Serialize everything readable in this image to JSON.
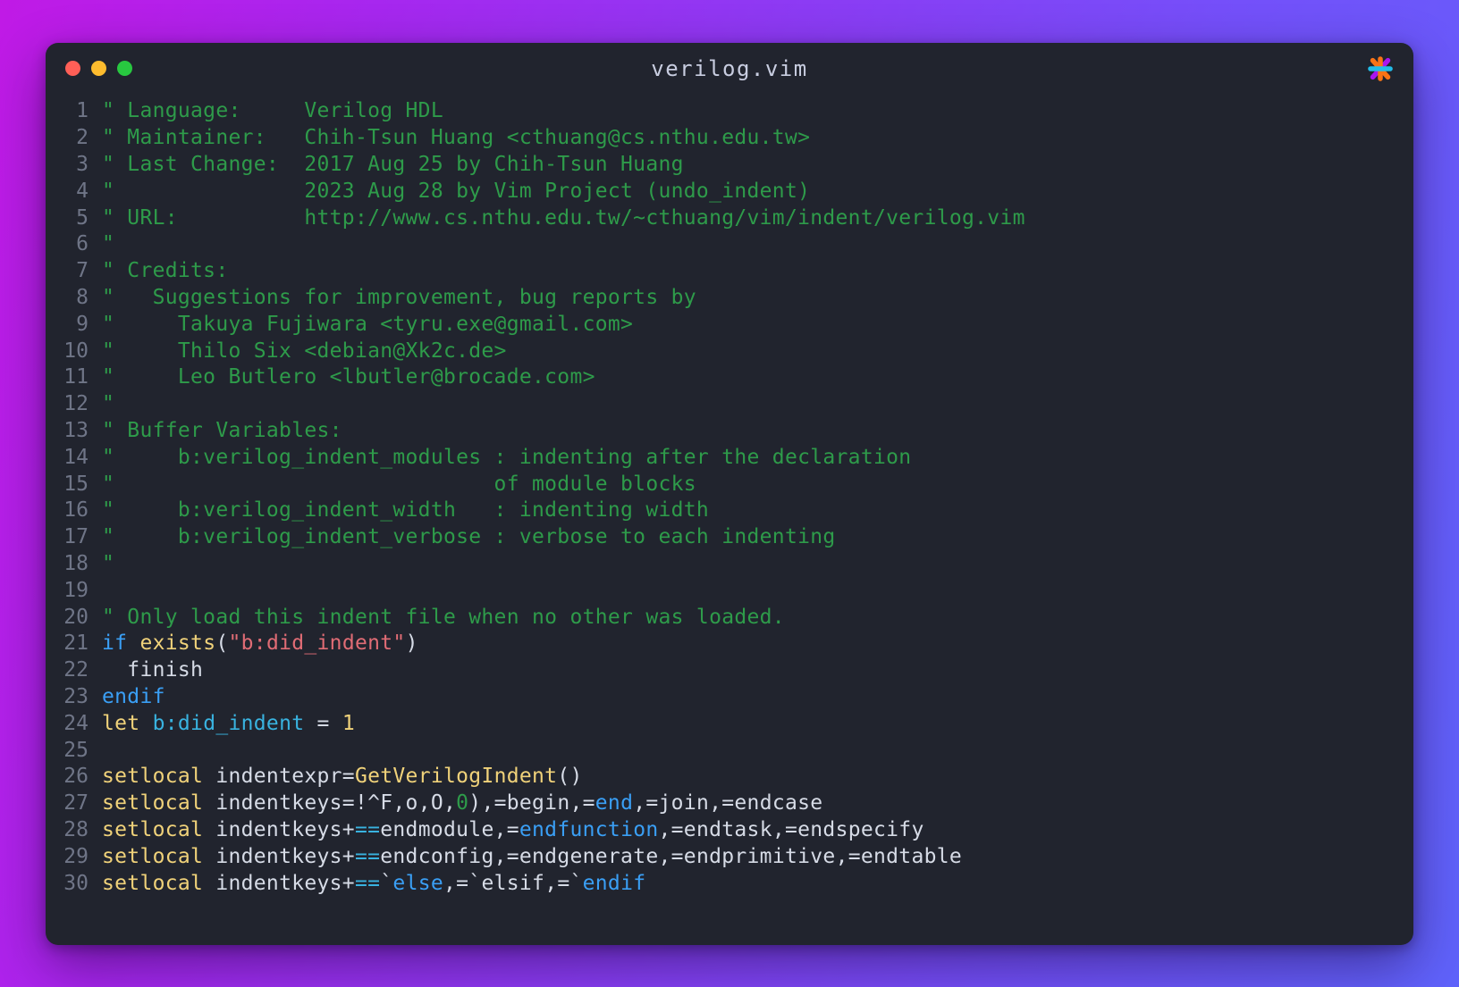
{
  "window": {
    "title": "verilog.vim",
    "traffic_lights": [
      {
        "name": "close",
        "color": "#ff5f57"
      },
      {
        "name": "minimize",
        "color": "#febc2e"
      },
      {
        "name": "maximize",
        "color": "#28c840"
      }
    ],
    "brand_icon": "asterisk-star-icon",
    "background_gradient": [
      "#c01ae6",
      "#5f63fb"
    ],
    "surface_color": "#21242e"
  },
  "editor": {
    "language": "vim",
    "first_line": 1,
    "last_line": 30,
    "palette": {
      "line_number": "#6f7587",
      "text": "#d6dbe6",
      "comment": "#2e9b4a",
      "keyword": "#3a9ff5",
      "function": "#f0d27a",
      "string": "#e06c75",
      "operator": "#2e9b4a",
      "cyan": "#39b3e0"
    },
    "lines": [
      {
        "n": "1",
        "tokens": [
          {
            "t": "comment",
            "v": "\" Language:     Verilog HDL"
          }
        ]
      },
      {
        "n": "2",
        "tokens": [
          {
            "t": "comment",
            "v": "\" Maintainer:   Chih-Tsun Huang <cthuang@cs.nthu.edu.tw>"
          }
        ]
      },
      {
        "n": "3",
        "tokens": [
          {
            "t": "comment",
            "v": "\" Last Change:  2017 Aug 25 by Chih-Tsun Huang"
          }
        ]
      },
      {
        "n": "4",
        "tokens": [
          {
            "t": "comment",
            "v": "\"               2023 Aug 28 by Vim Project (undo_indent)"
          }
        ]
      },
      {
        "n": "5",
        "tokens": [
          {
            "t": "comment",
            "v": "\" URL:          http://www.cs.nthu.edu.tw/~cthuang/vim/indent/verilog.vim"
          }
        ]
      },
      {
        "n": "6",
        "tokens": [
          {
            "t": "comment",
            "v": "\""
          }
        ]
      },
      {
        "n": "7",
        "tokens": [
          {
            "t": "comment",
            "v": "\" Credits:"
          }
        ]
      },
      {
        "n": "8",
        "tokens": [
          {
            "t": "comment",
            "v": "\"   Suggestions for improvement, bug reports by"
          }
        ]
      },
      {
        "n": "9",
        "tokens": [
          {
            "t": "comment",
            "v": "\"     Takuya Fujiwara <tyru.exe@gmail.com>"
          }
        ]
      },
      {
        "n": "10",
        "tokens": [
          {
            "t": "comment",
            "v": "\"     Thilo Six <debian@Xk2c.de>"
          }
        ]
      },
      {
        "n": "11",
        "tokens": [
          {
            "t": "comment",
            "v": "\"     Leo Butlero <lbutler@brocade.com>"
          }
        ]
      },
      {
        "n": "12",
        "tokens": [
          {
            "t": "comment",
            "v": "\""
          }
        ]
      },
      {
        "n": "13",
        "tokens": [
          {
            "t": "comment",
            "v": "\" Buffer Variables:"
          }
        ]
      },
      {
        "n": "14",
        "tokens": [
          {
            "t": "comment",
            "v": "\"     b:verilog_indent_modules : indenting after the declaration"
          }
        ]
      },
      {
        "n": "15",
        "tokens": [
          {
            "t": "comment",
            "v": "\"                              of module blocks"
          }
        ]
      },
      {
        "n": "16",
        "tokens": [
          {
            "t": "comment",
            "v": "\"     b:verilog_indent_width   : indenting width"
          }
        ]
      },
      {
        "n": "17",
        "tokens": [
          {
            "t": "comment",
            "v": "\"     b:verilog_indent_verbose : verbose to each indenting"
          }
        ]
      },
      {
        "n": "18",
        "tokens": [
          {
            "t": "comment",
            "v": "\""
          }
        ]
      },
      {
        "n": "19",
        "tokens": []
      },
      {
        "n": "20",
        "tokens": [
          {
            "t": "comment",
            "v": "\" Only load this indent file when no other was loaded."
          }
        ]
      },
      {
        "n": "21",
        "tokens": [
          {
            "t": "keyword",
            "v": "if"
          },
          {
            "t": "plain",
            "v": " "
          },
          {
            "t": "func",
            "v": "exists"
          },
          {
            "t": "plain",
            "v": "("
          },
          {
            "t": "string",
            "v": "\"b:did_indent\""
          },
          {
            "t": "plain",
            "v": ")"
          }
        ]
      },
      {
        "n": "22",
        "tokens": [
          {
            "t": "plain",
            "v": "  finish"
          }
        ]
      },
      {
        "n": "23",
        "tokens": [
          {
            "t": "keyword",
            "v": "endif"
          }
        ]
      },
      {
        "n": "24",
        "tokens": [
          {
            "t": "func",
            "v": "let"
          },
          {
            "t": "plain",
            "v": " "
          },
          {
            "t": "cyan",
            "v": "b:did_indent"
          },
          {
            "t": "plain",
            "v": " = "
          },
          {
            "t": "num",
            "v": "1"
          }
        ]
      },
      {
        "n": "25",
        "tokens": []
      },
      {
        "n": "26",
        "tokens": [
          {
            "t": "func",
            "v": "setlocal"
          },
          {
            "t": "plain",
            "v": " indentexpr="
          },
          {
            "t": "func",
            "v": "GetVerilogIndent"
          },
          {
            "t": "plain",
            "v": "()"
          }
        ]
      },
      {
        "n": "27",
        "tokens": [
          {
            "t": "func",
            "v": "setlocal"
          },
          {
            "t": "plain",
            "v": " indentkeys=!^F,o,O,"
          },
          {
            "t": "op",
            "v": "0"
          },
          {
            "t": "plain",
            "v": "),=begin,="
          },
          {
            "t": "keyword",
            "v": "end"
          },
          {
            "t": "plain",
            "v": ",=join,=endcase"
          }
        ]
      },
      {
        "n": "28",
        "tokens": [
          {
            "t": "func",
            "v": "setlocal"
          },
          {
            "t": "plain",
            "v": " indentkeys+"
          },
          {
            "t": "cyan",
            "v": "=="
          },
          {
            "t": "plain",
            "v": "endmodule,="
          },
          {
            "t": "keyword",
            "v": "endfunction"
          },
          {
            "t": "plain",
            "v": ",=endtask,=endspecify"
          }
        ]
      },
      {
        "n": "29",
        "tokens": [
          {
            "t": "func",
            "v": "setlocal"
          },
          {
            "t": "plain",
            "v": " indentkeys+"
          },
          {
            "t": "cyan",
            "v": "=="
          },
          {
            "t": "plain",
            "v": "endconfig,=endgenerate,=endprimitive,=endtable"
          }
        ]
      },
      {
        "n": "30",
        "tokens": [
          {
            "t": "func",
            "v": "setlocal"
          },
          {
            "t": "plain",
            "v": " indentkeys+"
          },
          {
            "t": "cyan",
            "v": "=="
          },
          {
            "t": "plain",
            "v": "`"
          },
          {
            "t": "keyword",
            "v": "else"
          },
          {
            "t": "plain",
            "v": ",=`elsif,=`"
          },
          {
            "t": "keyword",
            "v": "endif"
          }
        ]
      }
    ]
  }
}
